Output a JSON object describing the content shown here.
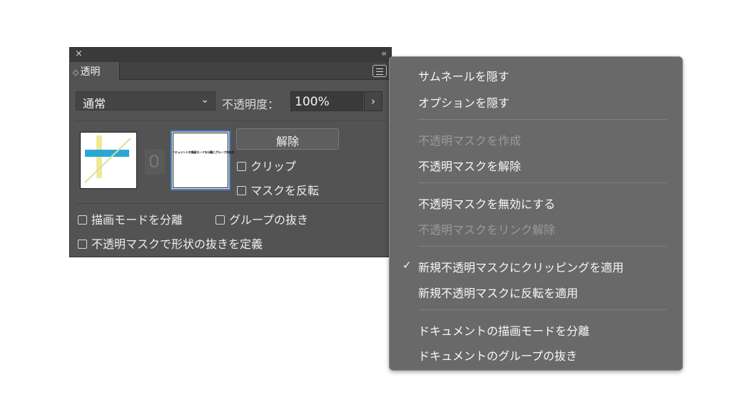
{
  "panel": {
    "close_icon": "×",
    "collapse_icon": "‹‹",
    "tab_icon": "◇",
    "tab_label": "透明",
    "blend_mode": "通常",
    "opacity_label": "不透明度：",
    "opacity_value": "100%",
    "release_button": "解除",
    "clip_label": "クリップ",
    "invert_label": "マスクを反転",
    "isolate_blending_label": "描画モードを分離",
    "knockout_group_label": "グループの抜き",
    "knockout_shape_label": "不透明マスクで形状の抜きを定義",
    "mask_thumb_text": "ドキュメントの描画モードを分離とグループの抜き"
  },
  "menu": {
    "items": [
      {
        "label": "サムネールを隠す",
        "enabled": true
      },
      {
        "label": "オプションを隠す",
        "enabled": true
      },
      {
        "label": "不透明マスクを作成",
        "enabled": false
      },
      {
        "label": "不透明マスクを解除",
        "enabled": true
      },
      {
        "label": "不透明マスクを無効にする",
        "enabled": true
      },
      {
        "label": "不透明マスクをリンク解除",
        "enabled": false
      },
      {
        "label": "新規不透明マスクにクリッピングを適用",
        "enabled": true,
        "checked": true
      },
      {
        "label": "新規不透明マスクに反転を適用",
        "enabled": true
      },
      {
        "label": "ドキュメントの描画モードを分離",
        "enabled": true
      },
      {
        "label": "ドキュメントのグループの抜き",
        "enabled": true
      }
    ],
    "check_mark": "✓"
  },
  "colors": {
    "panel_bg": "#535353",
    "menu_bg": "#696969",
    "selection_blue": "#4d7fc4",
    "art_cyan": "#2aa8d4",
    "art_yellow": "#f0e68c"
  }
}
